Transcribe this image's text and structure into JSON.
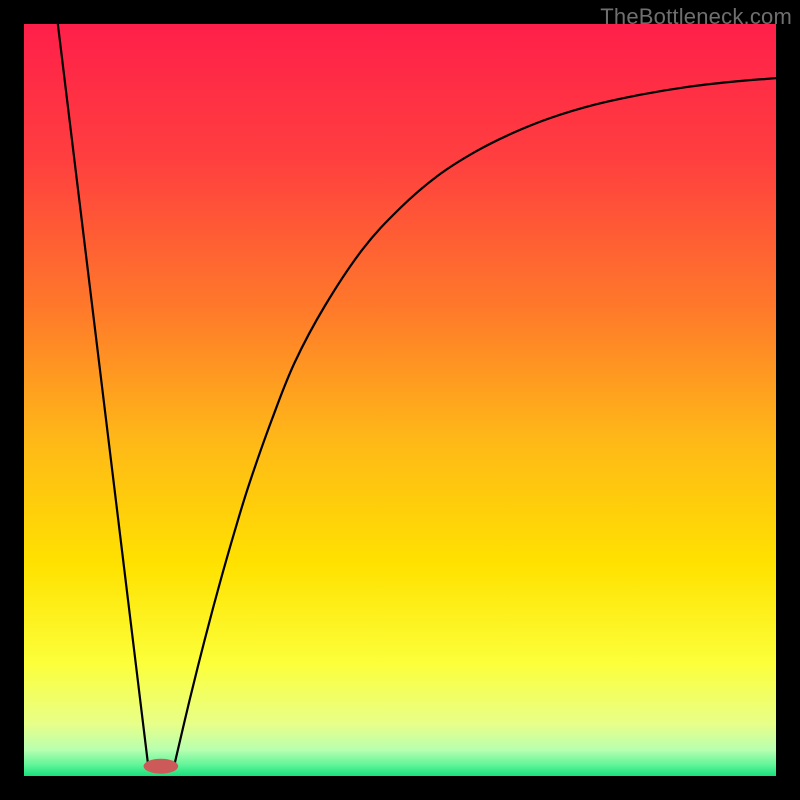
{
  "watermark": "TheBottleneck.com",
  "chart_data": {
    "type": "line",
    "title": "",
    "xlabel": "",
    "ylabel": "",
    "xlim": [
      0,
      100
    ],
    "ylim": [
      0,
      100
    ],
    "background_gradient_stops": [
      {
        "offset": 0.0,
        "color": "#ff1f4a"
      },
      {
        "offset": 0.18,
        "color": "#ff3f3f"
      },
      {
        "offset": 0.38,
        "color": "#ff7a2a"
      },
      {
        "offset": 0.55,
        "color": "#ffb718"
      },
      {
        "offset": 0.72,
        "color": "#ffe200"
      },
      {
        "offset": 0.85,
        "color": "#fcff3a"
      },
      {
        "offset": 0.93,
        "color": "#e8ff88"
      },
      {
        "offset": 0.965,
        "color": "#b8ffb0"
      },
      {
        "offset": 0.985,
        "color": "#62f59a"
      },
      {
        "offset": 1.0,
        "color": "#17e07b"
      }
    ],
    "series": [
      {
        "name": "left-line",
        "points": [
          {
            "x": 4.5,
            "y": 100
          },
          {
            "x": 16.5,
            "y": 1.5
          }
        ]
      },
      {
        "name": "right-curve",
        "points": [
          {
            "x": 20.0,
            "y": 1.5
          },
          {
            "x": 22.0,
            "y": 10.0
          },
          {
            "x": 24.0,
            "y": 18.0
          },
          {
            "x": 26.0,
            "y": 25.5
          },
          {
            "x": 28.0,
            "y": 32.5
          },
          {
            "x": 30.0,
            "y": 39.0
          },
          {
            "x": 33.0,
            "y": 47.5
          },
          {
            "x": 36.0,
            "y": 55.0
          },
          {
            "x": 40.0,
            "y": 62.5
          },
          {
            "x": 45.0,
            "y": 70.0
          },
          {
            "x": 50.0,
            "y": 75.5
          },
          {
            "x": 55.0,
            "y": 79.8
          },
          {
            "x": 60.0,
            "y": 83.0
          },
          {
            "x": 65.0,
            "y": 85.5
          },
          {
            "x": 70.0,
            "y": 87.5
          },
          {
            "x": 76.0,
            "y": 89.3
          },
          {
            "x": 82.0,
            "y": 90.6
          },
          {
            "x": 88.0,
            "y": 91.6
          },
          {
            "x": 94.0,
            "y": 92.3
          },
          {
            "x": 100.0,
            "y": 92.8
          }
        ]
      }
    ],
    "marker": {
      "name": "optimal-range",
      "x": 18.2,
      "y": 1.3,
      "rx": 2.3,
      "ry": 1.0,
      "fill": "#cc5a58"
    }
  }
}
